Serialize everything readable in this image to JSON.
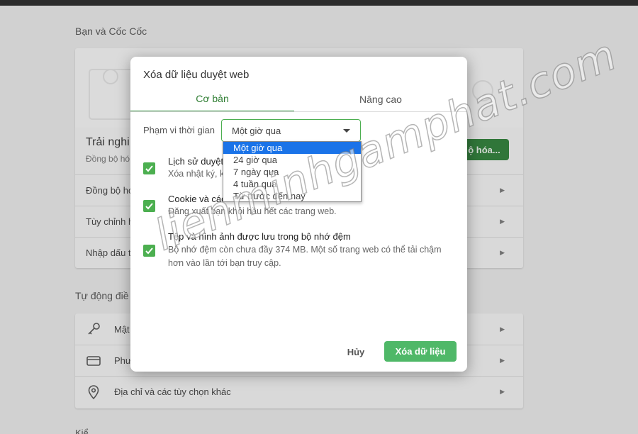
{
  "background": {
    "section1_heading": "Bạn và Cốc Cốc",
    "sync_title": "Trải nghi",
    "sync_subtitle": "Đồng bộ hó",
    "sync_button": "ộ hóa...",
    "rows1": [
      "Đồng bộ hó",
      "Tùy chỉnh h",
      "Nhập dấu t"
    ],
    "section2_heading": "Tự động điề",
    "rows2": [
      "Mật",
      "Phư",
      "Địa chỉ và các tùy chọn khác"
    ],
    "section3_heading": "Kiể"
  },
  "dialog": {
    "title": "Xóa dữ liệu duyệt web",
    "tabs": [
      "Cơ bản",
      "Nâng cao"
    ],
    "time_range_label": "Phạm vi thời gian",
    "time_range_value": "Một giờ qua",
    "options": [
      {
        "title": "Lịch sử duyệt",
        "desc": "Xóa nhật ký, k",
        "checked": true
      },
      {
        "title": "Cookie và các",
        "desc": "Đăng xuất bạn khỏi hầu hết các trang web.",
        "checked": true
      },
      {
        "title": "Tệp và hình ảnh được lưu trong bộ nhớ đệm",
        "desc": "Bộ nhớ đệm còn chưa đầy 374 MB. Một số trang web có thể tải chậm hơn vào lần tới bạn truy cập.",
        "checked": true
      }
    ],
    "cancel_label": "Hủy",
    "clear_label": "Xóa dữ liệu"
  },
  "dropdown": {
    "items": [
      "Một giờ qua",
      "24 giờ qua",
      "7 ngày qua",
      "4 tuần qua",
      "Từ trước đến nay"
    ],
    "selected_index": 0
  },
  "watermark": "lienminhgamphat.com",
  "colors": {
    "accent_green": "#4caf50",
    "selected_blue": "#1a73e8",
    "sync_green": "#2f7f3a"
  }
}
